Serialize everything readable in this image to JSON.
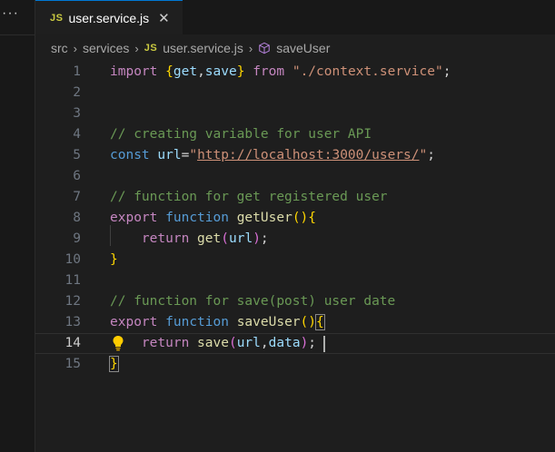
{
  "left_panel": {
    "more_label": "···"
  },
  "tab": {
    "icon": "JS",
    "filename": "user.service.js",
    "close": "✕"
  },
  "breadcrumb": {
    "items": [
      "src",
      "services",
      "user.service.js",
      "saveUser"
    ],
    "separator": "›",
    "js_icon": "JS",
    "symbol_icon": "cube-icon"
  },
  "editor": {
    "current_line": 14,
    "lines": [
      {
        "n": "1"
      },
      {
        "n": "2"
      },
      {
        "n": "3"
      },
      {
        "n": "4"
      },
      {
        "n": "5"
      },
      {
        "n": "6"
      },
      {
        "n": "7"
      },
      {
        "n": "8"
      },
      {
        "n": "9"
      },
      {
        "n": "10"
      },
      {
        "n": "11"
      },
      {
        "n": "12"
      },
      {
        "n": "13"
      },
      {
        "n": "14"
      },
      {
        "n": "15"
      }
    ],
    "tokens": {
      "import": "import",
      "lbrace": "{",
      "get": "get",
      "comma": ",",
      "save": "save",
      "rbrace": "}",
      "from": "from",
      "module": "\"./context.service\"",
      "semi": ";",
      "comment1": "// creating variable for user API",
      "const": "const",
      "url": "url",
      "eq": "=",
      "q": "\"",
      "url_value": "http://localhost:3000/users/",
      "comment2": "// function for get registered user",
      "export": "export",
      "function": "function",
      "getUser": "getUser",
      "lparen": "(",
      "rparen": ")",
      "return": "return",
      "comment3": "// function for save(post) user date",
      "saveUser": "saveUser",
      "data": "data"
    }
  },
  "colors": {
    "background": "#1e1e1e",
    "accent": "#0078d4",
    "js_icon": "#cbcb41"
  }
}
